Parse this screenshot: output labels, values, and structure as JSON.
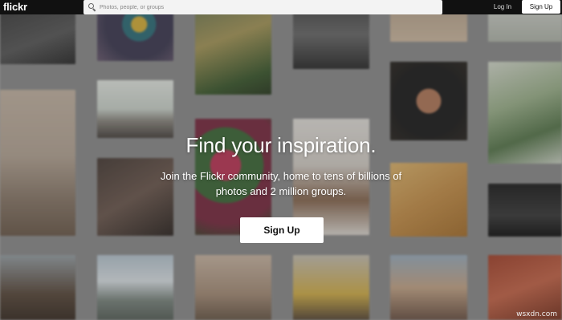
{
  "header": {
    "logo": "flickr",
    "search": {
      "placeholder": "Photos, people, or groups",
      "value": ""
    },
    "login_label": "Log In",
    "signup_label": "Sign Up"
  },
  "hero": {
    "title": "Find your inspiration.",
    "subtitle": "Join the Flickr community, home to tens of billions of photos and 2 million groups.",
    "cta_label": "Sign Up"
  },
  "watermark": "wsxdn.com",
  "colors": {
    "topbar": "#111111",
    "page_background": "#8e8e8e",
    "button_background": "#ffffff",
    "hero_text": "#ffffff"
  }
}
